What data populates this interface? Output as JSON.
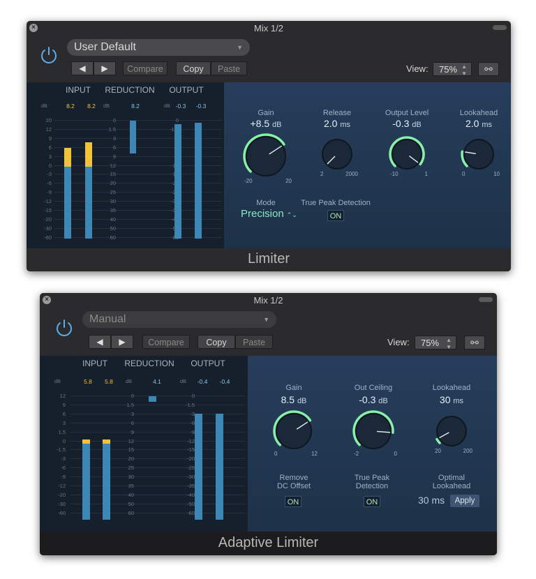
{
  "colors": {
    "accent_green": "#88f0a8",
    "meter_blue": "#3d86b5",
    "meter_yellow": "#f2c23a",
    "panel_blue": "#263e5c"
  },
  "limiter": {
    "title": "Mix 1/2",
    "preset": "User Default",
    "prev_label": "◀",
    "next_label": "▶",
    "compare_label": "Compare",
    "copy_label": "Copy",
    "paste_label": "Paste",
    "view_label": "View:",
    "view_value": "75%",
    "link_icon": "link-icon",
    "meter_headers": [
      "INPUT",
      "REDUCTION",
      "OUTPUT"
    ],
    "db_label": "dB",
    "input_peaks": [
      "8.2",
      "8.2"
    ],
    "reduction_peak": "8.2",
    "output_peaks": [
      "-0.3",
      "-0.3"
    ],
    "input_scale": [
      "20",
      "12",
      "9",
      "6",
      "3",
      "0",
      "-3",
      "-6",
      "-9",
      "-12",
      "-15",
      "-20",
      "-30",
      "-60"
    ],
    "reduction_scale": [
      "0",
      "1.5",
      "3",
      "6",
      "9",
      "12",
      "15",
      "20",
      "25",
      "30",
      "35",
      "40",
      "50",
      "60"
    ],
    "output_scale": [
      "0",
      "-1.5",
      "-3",
      "-6",
      "-9",
      "-12",
      "-15",
      "-20",
      "-25",
      "-30",
      "-35",
      "-40",
      "-50",
      "-60"
    ],
    "params": [
      {
        "label": "Gain",
        "value": "+8.5",
        "unit": "dB",
        "min": "-20",
        "max": "20",
        "level": 0.71
      },
      {
        "label": "Release",
        "value": "2.0",
        "unit": "ms",
        "min": "2",
        "max": "2000",
        "level": 0.0
      },
      {
        "label": "Output Level",
        "value": "-0.3",
        "unit": "dB",
        "min": "-10",
        "max": "1",
        "level": 0.97
      },
      {
        "label": "Lookahead",
        "value": "2.0",
        "unit": "ms",
        "min": "0",
        "max": "10",
        "level": 0.2
      }
    ],
    "mode_label": "Mode",
    "mode_value": "Precision",
    "mode_arrows": "⌃⌄",
    "true_peak_label": "True Peak Detection",
    "true_peak_value": "ON",
    "footer": "Limiter"
  },
  "adaptive": {
    "title": "Mix 1/2",
    "preset": "Manual",
    "prev_label": "◀",
    "next_label": "▶",
    "compare_label": "Compare",
    "copy_label": "Copy",
    "paste_label": "Paste",
    "view_label": "View:",
    "view_value": "75%",
    "meter_headers": [
      "INPUT",
      "REDUCTION",
      "OUTPUT"
    ],
    "db_label": "dB",
    "input_peaks": [
      "5.8",
      "5.8"
    ],
    "reduction_peak": "4.1",
    "output_peaks": [
      "-0.4",
      "-0.4"
    ],
    "input_scale": [
      "12",
      "9",
      "6",
      "3",
      "1.5",
      "0",
      "-1.5",
      "-3",
      "-6",
      "-9",
      "-12",
      "-20",
      "-30",
      "-60"
    ],
    "reduction_scale": [
      "0",
      "1.5",
      "3",
      "6",
      "9",
      "12",
      "15",
      "20",
      "25",
      "30",
      "35",
      "40",
      "50",
      "60"
    ],
    "output_scale": [
      "0",
      "-1.5",
      "-3",
      "-6",
      "-9",
      "-12",
      "-15",
      "-20",
      "-25",
      "-30",
      "-35",
      "-40",
      "-50",
      "-60"
    ],
    "params": [
      {
        "label": "Gain",
        "value": "8.5",
        "unit": "dB",
        "min": "0",
        "max": "12",
        "level": 0.71
      },
      {
        "label": "Out Ceiling",
        "value": "-0.3",
        "unit": "dB",
        "min": "-2",
        "max": "0",
        "level": 0.85
      },
      {
        "label": "Lookahead",
        "value": "30",
        "unit": "ms",
        "min": "20",
        "max": "200",
        "level": 0.06
      }
    ],
    "dc_label_1": "Remove",
    "dc_label_2": "DC Offset",
    "dc_value": "ON",
    "tp_label_1": "True Peak",
    "tp_label_2": "Detection",
    "tp_value": "ON",
    "opt_label_1": "Optimal",
    "opt_label_2": "Lookahead",
    "opt_value": "30 ms",
    "apply_label": "Apply",
    "footer": "Adaptive Limiter"
  }
}
